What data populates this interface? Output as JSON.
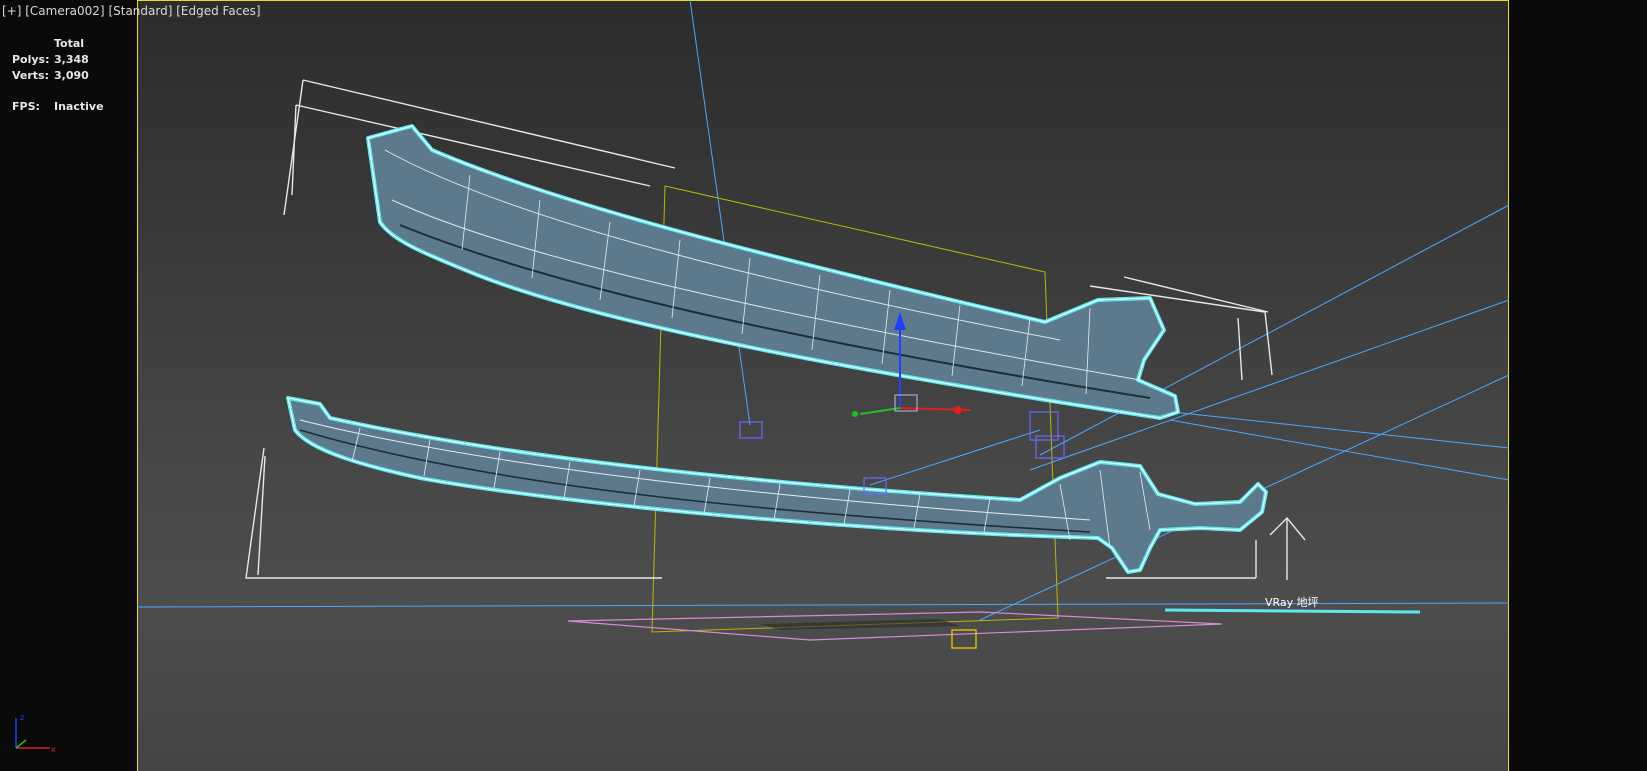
{
  "viewport": {
    "label_plus": "[+]",
    "label_camera": "[Camera002]",
    "label_shading": "[Standard]",
    "label_mode": "[Edged Faces]"
  },
  "stats": {
    "total_label": "Total",
    "polys_label": "Polys:",
    "polys_value": "3,348",
    "verts_label": "Verts:",
    "verts_value": "3,090",
    "fps_label": "FPS:",
    "fps_value": "Inactive"
  },
  "scene": {
    "floor_object_label": "VRay 地坪",
    "selection_color": "#5fe8f0",
    "wire_color": "#e8e8e8",
    "light_line_color": "#4aa8ff",
    "camera_frame_color": "#c8c800"
  },
  "icons": {
    "world_axis": "axis-tripod-icon",
    "transform_gizmo": "move-gizmo-icon"
  }
}
